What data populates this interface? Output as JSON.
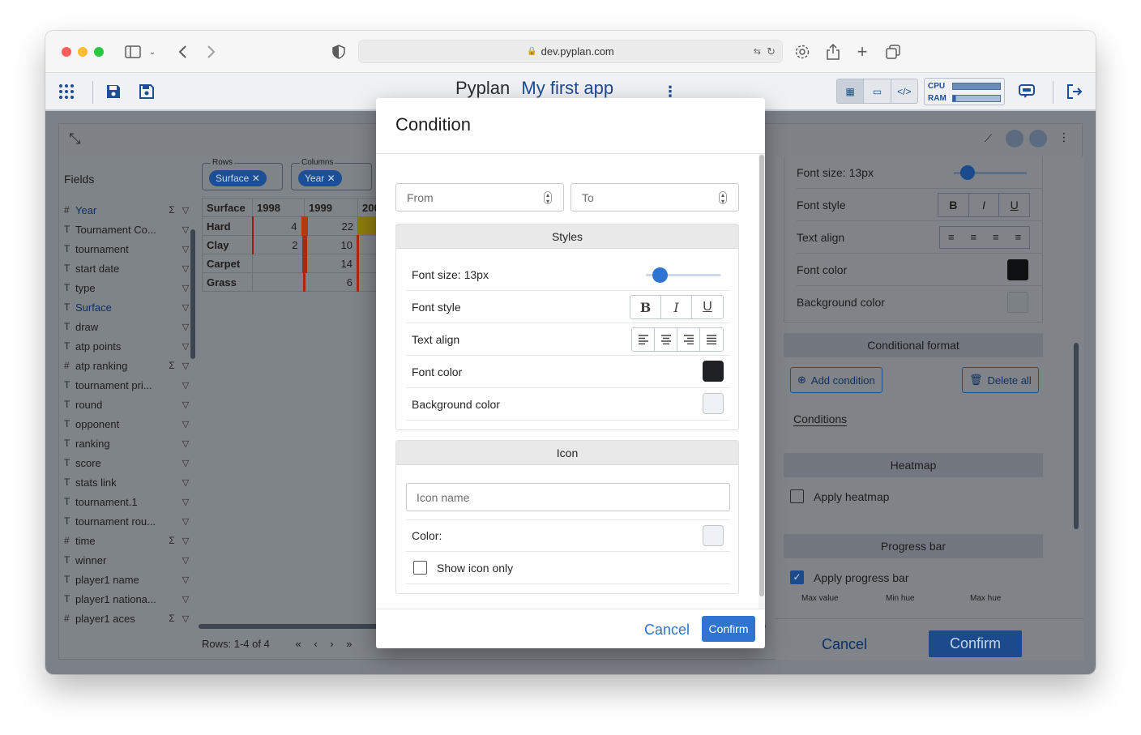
{
  "browser": {
    "url": "dev.pyplan.com"
  },
  "app": {
    "name": "Pyplan",
    "title": "My first app",
    "cpu_label": "CPU",
    "ram_label": "RAM"
  },
  "fields": {
    "title": "Fields",
    "items": [
      {
        "type": "#",
        "name": "Year",
        "sigma": "Σ",
        "highlight": true
      },
      {
        "type": "T",
        "name": "Tournament Co...",
        "sigma": ""
      },
      {
        "type": "T",
        "name": "tournament",
        "sigma": ""
      },
      {
        "type": "T",
        "name": "start date",
        "sigma": ""
      },
      {
        "type": "T",
        "name": "type",
        "sigma": ""
      },
      {
        "type": "T",
        "name": "Surface",
        "sigma": "",
        "highlight": true
      },
      {
        "type": "T",
        "name": "draw",
        "sigma": ""
      },
      {
        "type": "T",
        "name": "atp points",
        "sigma": ""
      },
      {
        "type": "#",
        "name": "atp ranking",
        "sigma": "Σ"
      },
      {
        "type": "T",
        "name": "tournament pri...",
        "sigma": ""
      },
      {
        "type": "T",
        "name": "round",
        "sigma": ""
      },
      {
        "type": "T",
        "name": "opponent",
        "sigma": ""
      },
      {
        "type": "T",
        "name": "ranking",
        "sigma": ""
      },
      {
        "type": "T",
        "name": "score",
        "sigma": ""
      },
      {
        "type": "T",
        "name": "stats link",
        "sigma": ""
      },
      {
        "type": "T",
        "name": "tournament.1",
        "sigma": ""
      },
      {
        "type": "T",
        "name": "tournament rou...",
        "sigma": ""
      },
      {
        "type": "#",
        "name": "time",
        "sigma": "Σ"
      },
      {
        "type": "T",
        "name": "winner",
        "sigma": ""
      },
      {
        "type": "T",
        "name": "player1 name",
        "sigma": ""
      },
      {
        "type": "T",
        "name": "player1 nationa...",
        "sigma": ""
      },
      {
        "type": "#",
        "name": "player1 aces",
        "sigma": "Σ"
      }
    ]
  },
  "pivot": {
    "rows_label": "Rows",
    "columns_label": "Columns",
    "row_chip": "Surface",
    "column_chip": "Year",
    "header": [
      "Surface",
      "1998",
      "1999",
      "200"
    ],
    "rows": [
      {
        "label": "Hard",
        "v1998": "4",
        "v1999": "22"
      },
      {
        "label": "Clay",
        "v1998": "2",
        "v1999": "10"
      },
      {
        "label": "Carpet",
        "v1998": "",
        "v1999": "14"
      },
      {
        "label": "Grass",
        "v1998": "",
        "v1999": "6"
      }
    ],
    "pager": "Rows: 1-4 of 4"
  },
  "right_panel": {
    "font_size": "Font size: 13px",
    "font_style": "Font style",
    "text_align": "Text align",
    "font_color": "Font color",
    "background_color": "Background color",
    "conditional_format": "Conditional format",
    "add_condition": "Add condition",
    "delete_all": "Delete all",
    "conditions": "Conditions",
    "heatmap": "Heatmap",
    "apply_heatmap": "Apply heatmap",
    "progress_bar": "Progress bar",
    "apply_progress_bar": "Apply progress bar",
    "max_value": "Max value",
    "min_hue": "Min hue",
    "max_hue": "Max hue",
    "cancel": "Cancel",
    "confirm": "Confirm"
  },
  "modal": {
    "title": "Condition",
    "from_placeholder": "From",
    "to_placeholder": "To",
    "styles_header": "Styles",
    "font_size": "Font size: 13px",
    "font_style": "Font style",
    "text_align": "Text align",
    "font_color": "Font color",
    "background_color": "Background color",
    "icon_header": "Icon",
    "icon_name_placeholder": "Icon name",
    "color_label": "Color:",
    "show_icon_only": "Show icon only",
    "cancel": "Cancel",
    "confirm": "Confirm",
    "colors": {
      "font_color": "#1f2125",
      "background_color": "#eef1f5",
      "icon_color": "#eef1f5",
      "accent": "#2f74d0"
    }
  }
}
